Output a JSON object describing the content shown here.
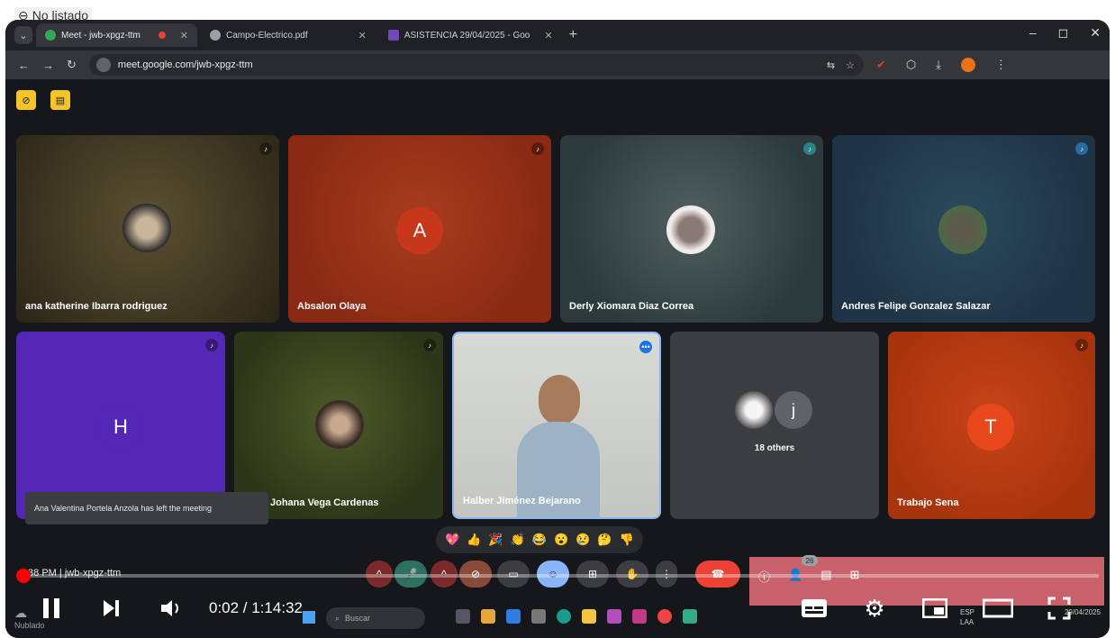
{
  "badge": {
    "label": "No listado"
  },
  "browser": {
    "tabs": [
      {
        "label": "Meet - jwb-xpgz-ttm",
        "active": true
      },
      {
        "label": "Campo-Electrico.pdf",
        "active": false
      },
      {
        "label": "ASISTENCIA 29/04/2025 - Goo",
        "active": false
      }
    ],
    "url": "meet.google.com/jwb-xpgz-ttm"
  },
  "meet": {
    "tiles": [
      {
        "name": "ana katherine Ibarra rodriguez",
        "type": "photo"
      },
      {
        "name": "Absalon Olaya",
        "type": "initial",
        "initial": "A",
        "color": "#c13a1a"
      },
      {
        "name": "Derly Xiomara Diaz Correa",
        "type": "photo"
      },
      {
        "name": "Andres Felipe Gonzalez Salazar",
        "type": "photo"
      },
      {
        "name": "",
        "type": "initial",
        "initial": "H",
        "color": "#5627b8"
      },
      {
        "name": "Johana Vega Cardenas",
        "type": "photo"
      },
      {
        "name": "Halber Jiménez Bejarano",
        "type": "camera"
      },
      {
        "name": "18 others",
        "type": "group",
        "initial": "j"
      },
      {
        "name": "Trabajo Sena",
        "type": "initial",
        "initial": "T",
        "color": "#e8481c"
      }
    ],
    "notice": "Ana Valentina Portela Anzola has left the meeting",
    "meeting_info": ":38 PM  |  jwb-xpgz-ttm",
    "people_count": "26"
  },
  "player": {
    "time": "0:02 / 1:14:32",
    "progress_fraction": 0.0
  },
  "taskbar": {
    "cloud_label": "Nublado",
    "search_placeholder": "Buscar",
    "lang": "ESP\nLAA",
    "date": "29/04/2025"
  }
}
